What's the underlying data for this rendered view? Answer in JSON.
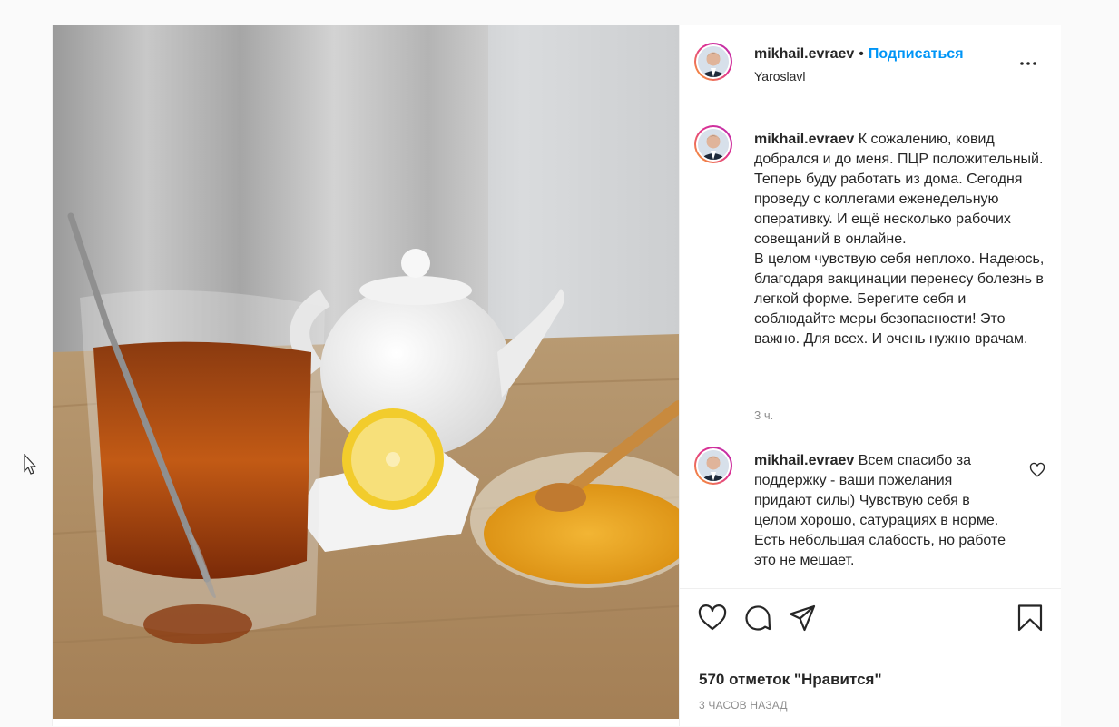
{
  "post": {
    "author": "mikhail.evraev",
    "follow_label": "Подписаться",
    "location": "Yaroslavl"
  },
  "comments": [
    {
      "author": "mikhail.evraev",
      "text": "К сожалению, ковид добрался и до меня. ПЦР положительный. Теперь буду работать из дома. Сегодня проведу с коллегами еженедельную оперативку. И ещё несколько рабочих совещаний в онлайне.\nВ целом чувствую себя неплохо. Надеюсь, благодаря вакцинации перенесу болезнь в легкой форме. Берегите себя и соблюдайте меры безопасности! Это важно. Для всех. И очень нужно врачам.",
      "time": "3 ч."
    },
    {
      "author": "mikhail.evraev",
      "text": "Всем спасибо за поддержку - ваши пожелания придают силы) Чувствую себя в целом хорошо, сатурациях в норме. Есть небольшая слабость, но работе это не мешает."
    }
  ],
  "footer": {
    "likes": "570 отметок \"Нравится\"",
    "posted_ago": "3 ЧАСОВ НАЗАД"
  },
  "icons": [
    "more-icon",
    "heart-icon",
    "comment-icon",
    "share-icon",
    "bookmark-icon",
    "cursor-icon"
  ],
  "colors": {
    "accent": "#0095f6",
    "text": "#262626",
    "muted": "#8e8e8e",
    "border": "#efefef"
  }
}
